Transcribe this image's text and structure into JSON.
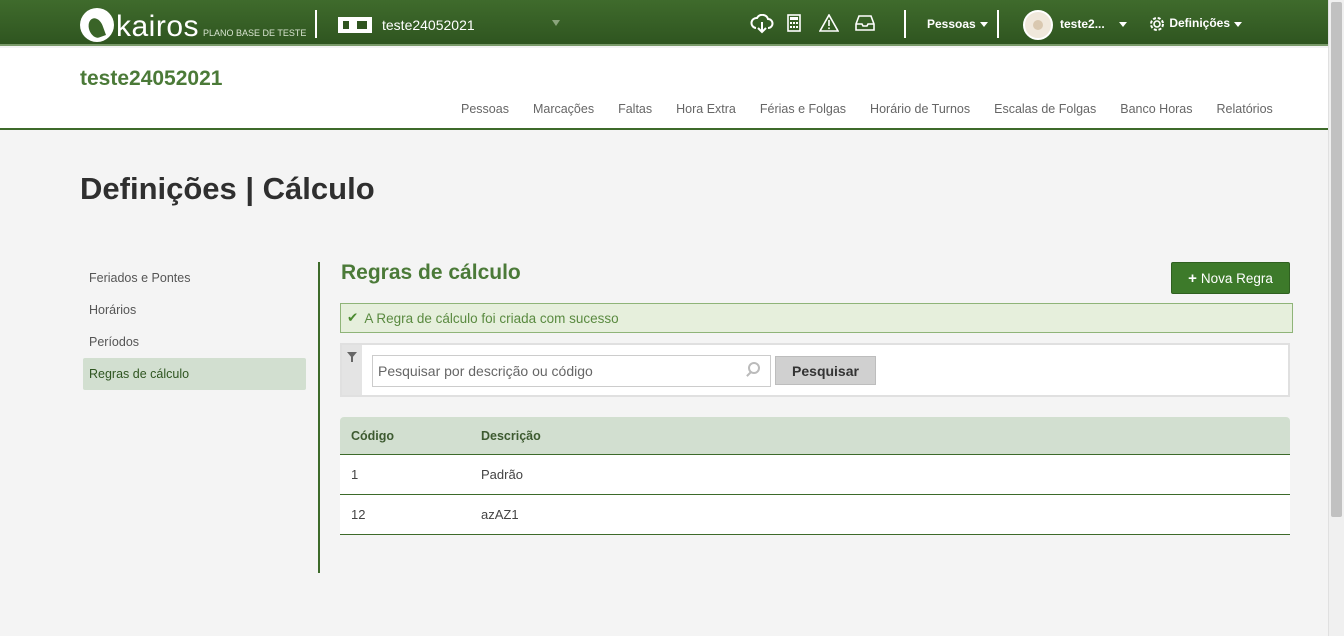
{
  "brand": {
    "name": "kairos",
    "subtitle": "PLANO BASE DE TESTE"
  },
  "topbar": {
    "company": "teste24052021",
    "icons": [
      "cloud-download-icon",
      "calculator-icon",
      "warning-icon",
      "inbox-icon"
    ],
    "people_menu": "Pessoas",
    "user_name": "teste2...",
    "settings_menu": "Definições"
  },
  "header": {
    "company_title": "teste24052021",
    "nav": [
      "Pessoas",
      "Marcações",
      "Faltas",
      "Hora Extra",
      "Férias e Folgas",
      "Horário de Turnos",
      "Escalas de Folgas",
      "Banco Horas",
      "Relatórios"
    ]
  },
  "page": {
    "title": "Definições | Cálculo"
  },
  "sidebar": {
    "items": [
      {
        "label": "Feriados e Pontes"
      },
      {
        "label": "Horários"
      },
      {
        "label": "Períodos"
      },
      {
        "label": "Regras de cálculo"
      }
    ],
    "active": "Regras de cálculo"
  },
  "content": {
    "title": "Regras de cálculo",
    "new_button": "Nova Regra",
    "alert": "A Regra de cálculo foi criada com sucesso",
    "search": {
      "placeholder": "Pesquisar por descrição ou código",
      "value": "",
      "button": "Pesquisar"
    },
    "table": {
      "headers": [
        "Código",
        "Descrição"
      ],
      "rows": [
        {
          "code": "1",
          "description": "Padrão"
        },
        {
          "code": "12",
          "description": "azAZ1"
        }
      ]
    }
  },
  "colors": {
    "primary": "#3d6a2a",
    "accent": "#4b7a38",
    "highlight": "#d2dfd0"
  }
}
